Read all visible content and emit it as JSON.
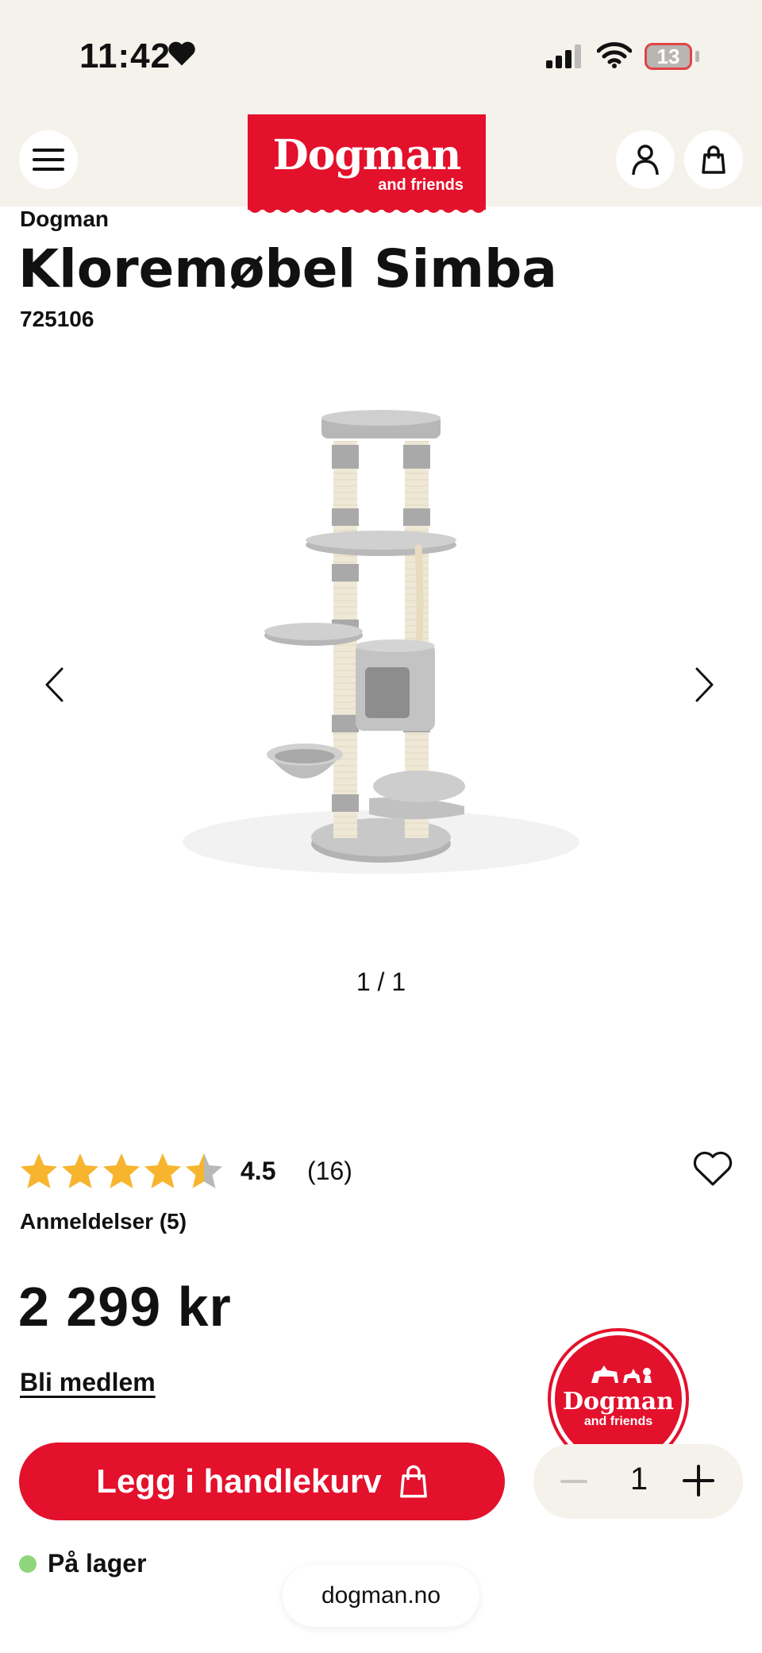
{
  "status_bar": {
    "time": "11:42",
    "battery": "13"
  },
  "header": {
    "logo_main": "Dogman",
    "logo_sub": "and friends"
  },
  "product": {
    "brand": "Dogman",
    "title": "Kloremøbel Simba",
    "sku": "725106",
    "image_counter": "1 / 1",
    "rating": "4.5",
    "rating_fraction": 0.9,
    "rating_count": "(16)",
    "reviews_label": "Anmeldelser (5)",
    "price": "2 299 kr",
    "member_link": "Bli medlem",
    "add_to_cart": "Legg i handlekurv",
    "quantity": "1",
    "stock": "På lager"
  },
  "badge": {
    "main": "Dogman",
    "sub": "and friends"
  },
  "browser": {
    "url": "dogman.no"
  },
  "colors": {
    "brand_red": "#e3112c",
    "header_bg": "#f5f2ec",
    "star": "#f7b52f",
    "star_empty": "#b8b8b8",
    "stock_green": "#8fd67a"
  }
}
